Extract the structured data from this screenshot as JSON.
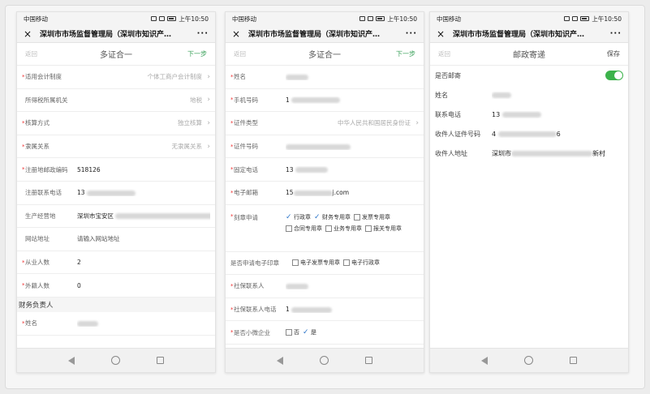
{
  "common": {
    "carrier": "中国移动",
    "time": "上午10:50",
    "window_title": "深圳市市场监督管理局（深圳市知识产…",
    "close": "×",
    "more": "···"
  },
  "phone1": {
    "nav": {
      "back": "返回",
      "title": "多证合一",
      "next": "下一步"
    },
    "rows": [
      {
        "required": "*",
        "label": "适用会计制度",
        "value": "个体工商户会计制度"
      },
      {
        "required": "",
        "label": "所得税所属机关",
        "value": "地税"
      },
      {
        "required": "*",
        "label": "核算方式",
        "value": "独立核算"
      },
      {
        "required": "*",
        "label": "隶属关系",
        "value": "无隶属关系"
      },
      {
        "required": "*",
        "label": "注册地邮政编码",
        "value": "518126"
      },
      {
        "required": "",
        "label": "注册联系电话",
        "value": "13"
      },
      {
        "required": "",
        "label": "生产经营地",
        "value": "深圳市宝安区"
      },
      {
        "required": "",
        "label": "网站地址",
        "value": "请输入网站地址"
      },
      {
        "required": "*",
        "label": "从业人数",
        "value": "2"
      },
      {
        "required": "*",
        "label": "外籍人数",
        "value": "0"
      }
    ],
    "section": "财务负责人",
    "rows2": [
      {
        "required": "*",
        "label": "姓名",
        "value": ""
      }
    ]
  },
  "phone2": {
    "nav": {
      "back": "返回",
      "title": "多证合一",
      "next": "下一步"
    },
    "rows": [
      {
        "required": "*",
        "label": "姓名",
        "value": ""
      },
      {
        "required": "*",
        "label": "手机号码",
        "value": "1"
      },
      {
        "required": "*",
        "label": "证件类型",
        "value": "中华人民共和国居民身份证"
      },
      {
        "required": "*",
        "label": "证件号码",
        "value": ""
      },
      {
        "required": "*",
        "label": "固定电话",
        "value": "13"
      },
      {
        "required": "*",
        "label": "电子邮箱",
        "value": "15",
        "suffix": "j.com"
      }
    ],
    "seal": {
      "required": "*",
      "label": "刻章申请",
      "options": [
        {
          "label": "行政章",
          "checked": true
        },
        {
          "label": "财务专用章",
          "checked": true
        },
        {
          "label": "发票专用章",
          "checked": false
        },
        {
          "label": "合同专用章",
          "checked": false
        },
        {
          "label": "业务专用章",
          "checked": false
        },
        {
          "label": "报关专用章",
          "checked": false
        }
      ]
    },
    "esign": {
      "label": "是否申请电子印章",
      "options": [
        {
          "label": "电子发票专用章",
          "checked": false
        },
        {
          "label": "电子行政章",
          "checked": false
        }
      ]
    },
    "rows2": [
      {
        "required": "*",
        "label": "社保联系人",
        "value": ""
      },
      {
        "required": "*",
        "label": "社保联系人电话",
        "value": "1"
      }
    ],
    "micro": {
      "required": "*",
      "label": "是否小微企业",
      "options": [
        {
          "label": "否",
          "checked": false
        },
        {
          "label": "是",
          "checked": true
        }
      ]
    }
  },
  "phone3": {
    "nav": {
      "back": "返回",
      "title": "邮政寄递",
      "save": "保存"
    },
    "mail_toggle": {
      "label": "是否邮寄",
      "on": true
    },
    "rows": [
      {
        "label": "姓名",
        "value": ""
      },
      {
        "label": "联系电话",
        "value": "13"
      },
      {
        "label": "收件人证件号码",
        "value": "4",
        "suffix": "6"
      },
      {
        "label": "收件人地址",
        "value": "深圳市",
        "suffix": "新村"
      }
    ]
  }
}
